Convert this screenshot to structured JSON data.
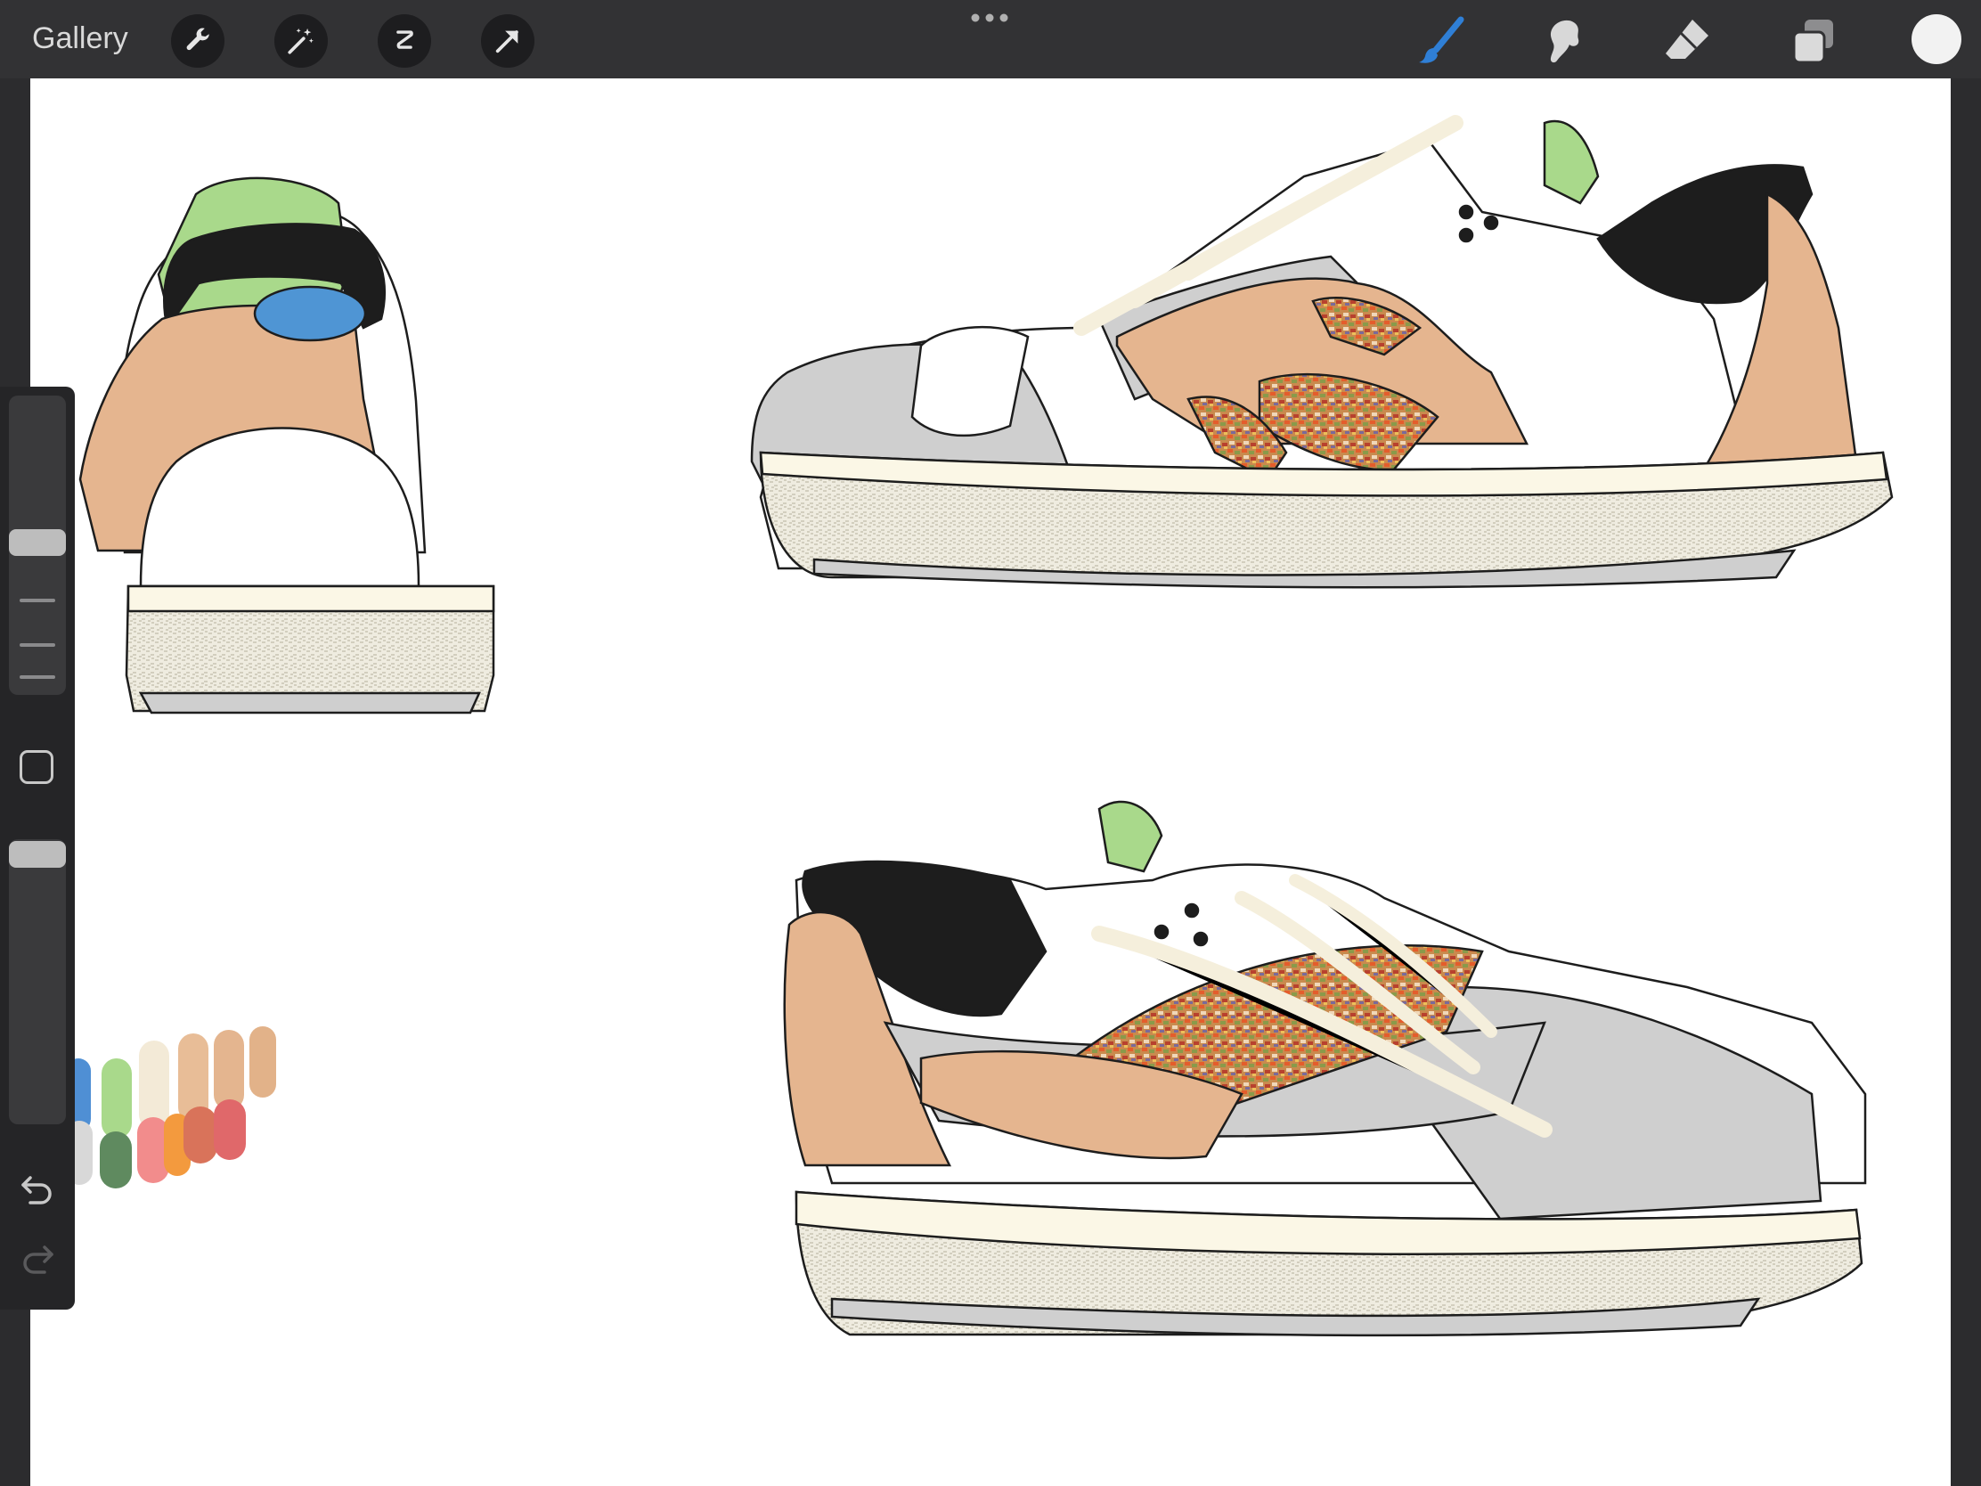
{
  "topbar": {
    "gallery_label": "Gallery",
    "left_tools": [
      "wrench-icon",
      "magic-wand-icon",
      "selection-icon",
      "transform-arrow-icon"
    ],
    "right_tools": [
      "brush-icon",
      "smudge-icon",
      "eraser-icon",
      "layers-icon"
    ],
    "active_tool": "brush-icon",
    "accent_color": "#2f7fd6",
    "current_color": "#f2f2f2"
  },
  "sidebar": {
    "controls": [
      "brush-size-slider",
      "modify-button",
      "opacity-slider",
      "undo-icon",
      "redo-icon"
    ]
  },
  "palette": {
    "colors": [
      "#4f8fd4",
      "#a9d98b",
      "#f3ead7",
      "#e8bd97",
      "#e4b58f",
      "#e2b289",
      "#d8d8d8",
      "#5f8a5f",
      "#f28c8c",
      "#f39a3e",
      "#d9735a",
      "#e0686a"
    ]
  },
  "sketch_colors": {
    "skin": "#e5b58f",
    "grey": "#cfcfcf",
    "sole": "#fbf7e6",
    "green": "#a9d98b",
    "black": "#1d1d1d",
    "blue": "#4f95d4",
    "lace": "#f5efdc"
  }
}
